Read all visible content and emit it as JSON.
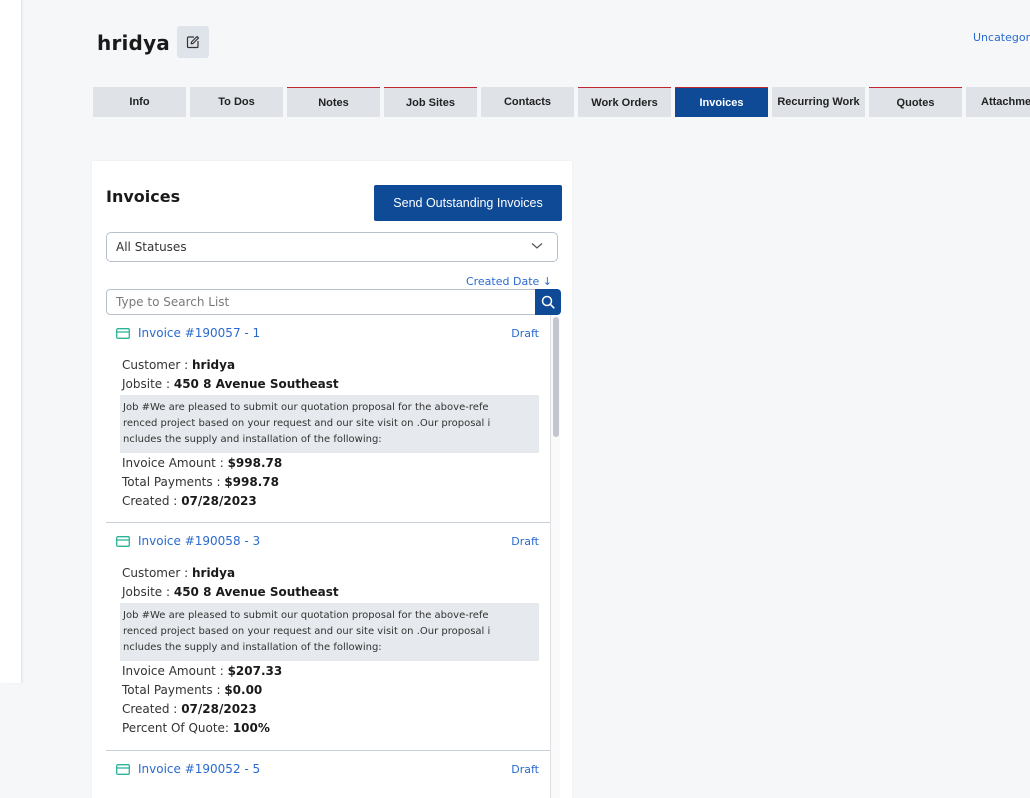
{
  "header": {
    "customer_name": "hridya",
    "category_link": "Uncategori"
  },
  "tabs": [
    {
      "label": "Info"
    },
    {
      "label": "To Dos"
    },
    {
      "label": "Notes"
    },
    {
      "label": "Job Sites"
    },
    {
      "label": "Contacts"
    },
    {
      "label": "Work Orders"
    },
    {
      "label": "Invoices"
    },
    {
      "label": "Recurring Work"
    },
    {
      "label": "Quotes"
    },
    {
      "label": "Attachmen"
    }
  ],
  "active_tab": "Invoices",
  "panel": {
    "title": "Invoices",
    "send_button": "Send Outstanding Invoices",
    "status_filter": "All Statuses",
    "sort_label": "Created Date ↓",
    "search_placeholder": "Type to Search List"
  },
  "labels": {
    "customer": "Customer :",
    "jobsite": "Jobsite :",
    "invoice_amount": "Invoice Amount :",
    "total_payments": "Total Payments :",
    "created": "Created :",
    "percent_of_quote": "Percent Of Quote:"
  },
  "invoices": [
    {
      "title": "Invoice #190057 - 1",
      "status": "Draft",
      "customer": "hridya",
      "jobsite": "450 8 Avenue Southeast",
      "description_lines": [
        "Job #We are pleased to submit our quotation proposal for the above-refe",
        "renced project based on your request and our site visit on .Our proposal i",
        "ncludes the supply and installation of the following:"
      ],
      "invoice_amount": "$998.78",
      "total_payments": "$998.78",
      "created": "07/28/2023"
    },
    {
      "title": "Invoice #190058 - 3",
      "status": "Draft",
      "customer": "hridya",
      "jobsite": "450 8 Avenue Southeast",
      "description_lines": [
        "Job #We are pleased to submit our quotation proposal for the above-refe",
        "renced project based on your request and our site visit on .Our proposal i",
        "ncludes the supply and installation of the following:"
      ],
      "invoice_amount": "$207.33",
      "total_payments": "$0.00",
      "created": "07/28/2023",
      "percent_of_quote": "100%"
    },
    {
      "title": "Invoice #190052 - 5",
      "status": "Draft"
    }
  ],
  "icons": {
    "edit": "edit-pencil-icon",
    "invoice": "credit-card-icon",
    "search": "search-icon",
    "dropdown": "chevron-down-icon"
  },
  "colors": {
    "primary": "#0e4a96",
    "link": "#2a6ad0",
    "tab_accent": "#c0262d",
    "invoice_icon": "#2bb39a"
  }
}
